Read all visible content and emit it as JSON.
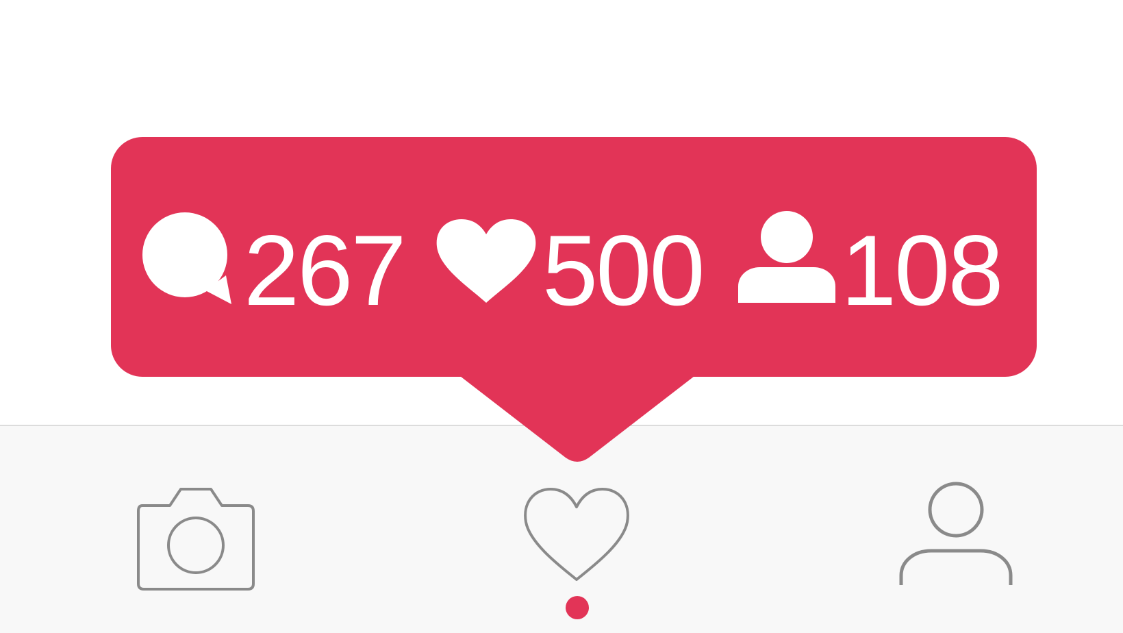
{
  "theme": {
    "accent": "#e23457",
    "tab_bar_background": "#f8f8f8",
    "icon_gray": "#8a8a8a",
    "text_on_accent": "#ffffff"
  },
  "notification": {
    "stats": {
      "comments": {
        "icon": "speech-bubble-icon",
        "value": "267"
      },
      "likes": {
        "icon": "heart-icon",
        "value": "500"
      },
      "followers": {
        "icon": "person-icon",
        "value": "108"
      }
    }
  },
  "tab_bar": {
    "tabs": [
      {
        "icon": "camera-icon",
        "active": false
      },
      {
        "icon": "heart-outline-icon",
        "active": true
      },
      {
        "icon": "profile-icon",
        "active": false
      }
    ]
  }
}
